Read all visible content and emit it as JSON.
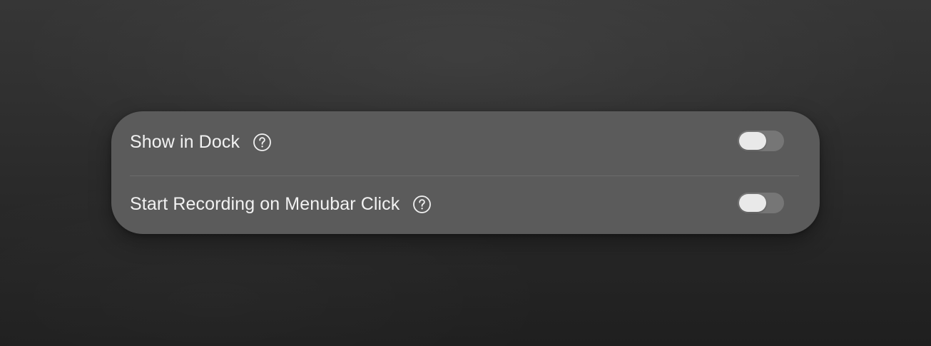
{
  "settings": {
    "items": [
      {
        "label": "Show in Dock",
        "help_icon": "question-circle-icon",
        "toggle_on": false
      },
      {
        "label": "Start Recording on Menubar Click",
        "help_icon": "question-circle-icon",
        "toggle_on": false
      }
    ]
  },
  "colors": {
    "panel_background": "#5b5b5b",
    "toggle_track_off": "#767676",
    "toggle_knob": "#e9e9e9",
    "text": "#f2f2f2"
  }
}
